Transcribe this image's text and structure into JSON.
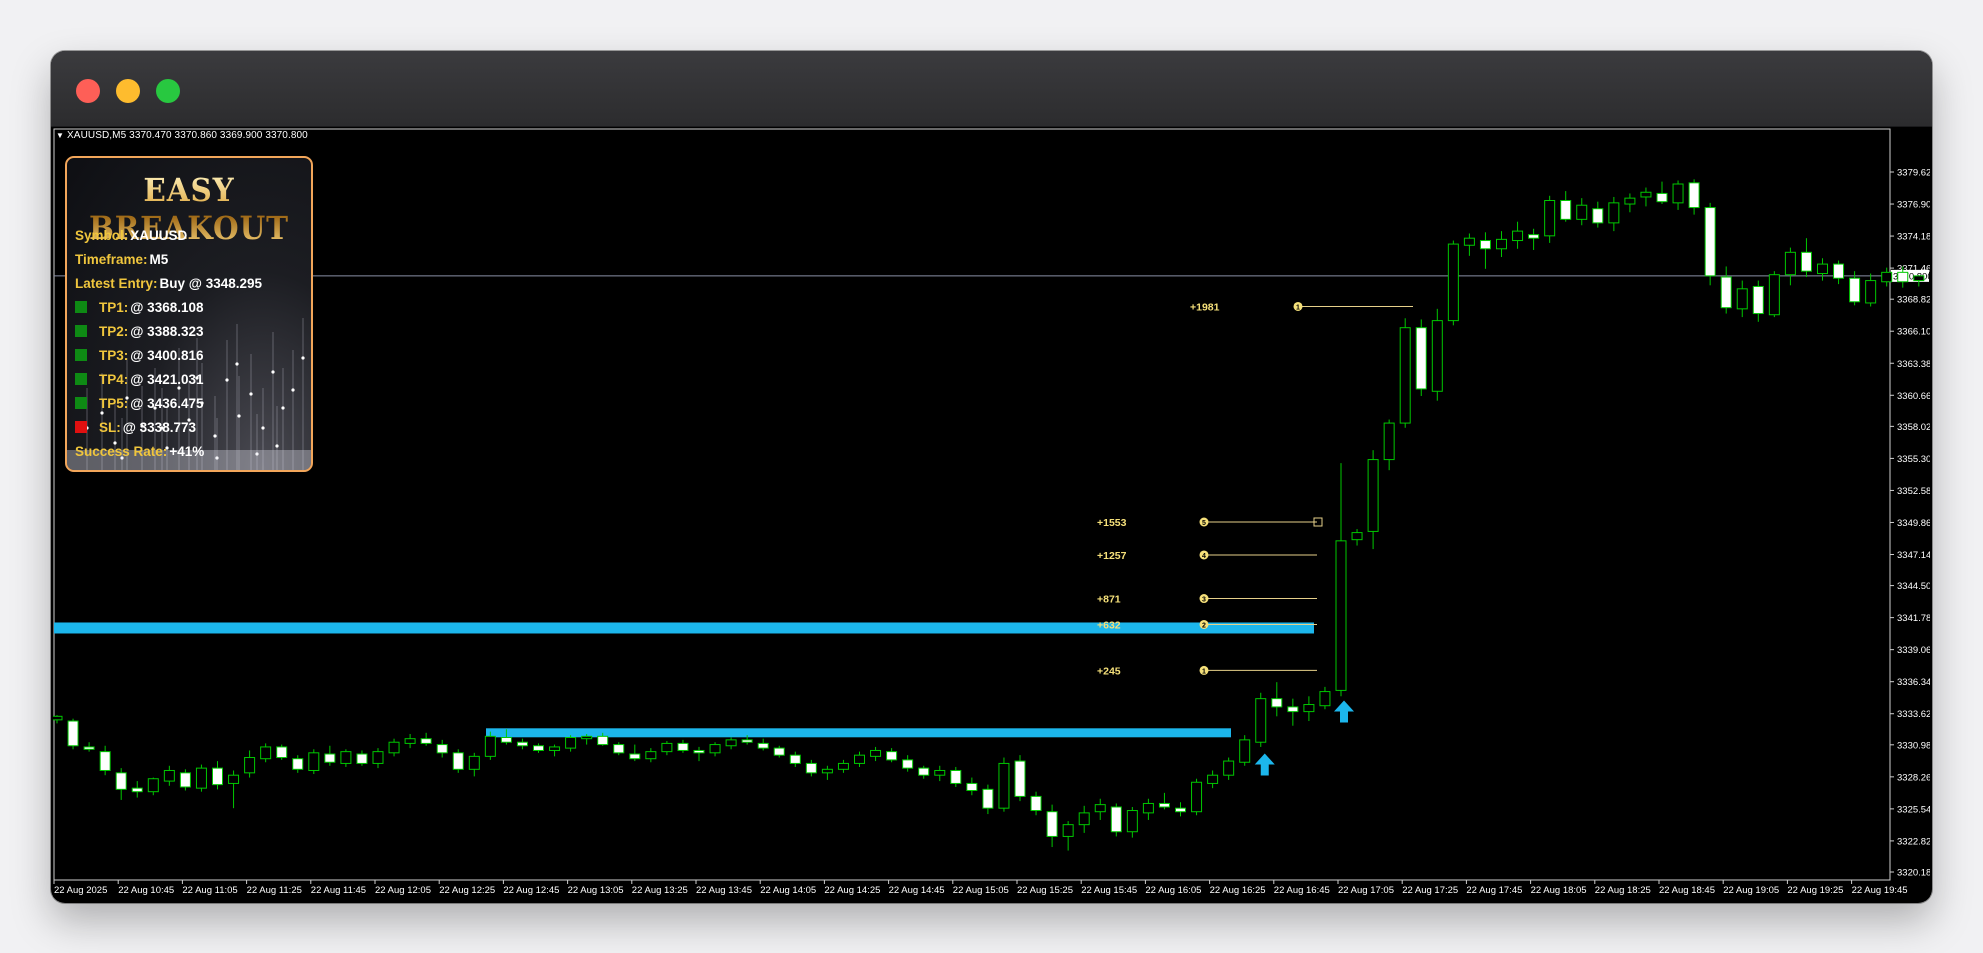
{
  "window": {
    "traffic_lights": {
      "close": "#fe5f57",
      "minimize": "#febc2e",
      "zoom": "#28c840"
    }
  },
  "chart": {
    "info_bar": "XAUUSD,M5  3370.470 3370.860 3369.900 3370.800",
    "current_price_label": "3370.800",
    "price_axis": [
      "3379.620",
      "3376.900",
      "3374.180",
      "3371.460",
      "3368.820",
      "3366.100",
      "3363.380",
      "3360.660",
      "3358.020",
      "3355.300",
      "3352.580",
      "3349.860",
      "3347.140",
      "3344.500",
      "3341.780",
      "3339.060",
      "3336.340",
      "3333.620",
      "3330.980",
      "3328.260",
      "3325.540",
      "3322.820",
      "3320.180"
    ],
    "time_axis": [
      "22 Aug 2025",
      "22 Aug 10:45",
      "22 Aug 11:05",
      "22 Aug 11:25",
      "22 Aug 11:45",
      "22 Aug 12:05",
      "22 Aug 12:25",
      "22 Aug 12:45",
      "22 Aug 13:05",
      "22 Aug 13:25",
      "22 Aug 13:45",
      "22 Aug 14:05",
      "22 Aug 14:25",
      "22 Aug 14:45",
      "22 Aug 15:05",
      "22 Aug 15:25",
      "22 Aug 15:45",
      "22 Aug 16:05",
      "22 Aug 16:25",
      "22 Aug 16:45",
      "22 Aug 17:05",
      "22 Aug 17:25",
      "22 Aug 17:45",
      "22 Aug 18:05",
      "22 Aug 18:25",
      "22 Aug 18:45",
      "22 Aug 19:05",
      "22 Aug 19:25",
      "22 Aug 19:45"
    ],
    "tp_labels": [
      {
        "label": "+1981",
        "marker": "1",
        "price": 3368.2
      },
      {
        "label": "+1553",
        "marker": "5",
        "price": 3349.9
      },
      {
        "label": "+1257",
        "marker": "4",
        "price": 3347.1
      },
      {
        "label": "+871",
        "marker": "3",
        "price": 3343.4
      },
      {
        "label": "+632",
        "marker": "2",
        "price": 3341.2
      },
      {
        "label": "+245",
        "marker": "1",
        "price": 3337.3
      }
    ],
    "colors": {
      "bull_candle": "#00c800",
      "bear_candle": "#ffffff",
      "breakout_zone": "#1cb6ec",
      "tp_line": "#e6d08a",
      "tp_text": "#f5e07a",
      "axis_text": "#ffffff"
    }
  },
  "panel": {
    "title": "EASY BREAKOUT",
    "symbol_label": "Symbol:",
    "symbol_value": "XAUUSD",
    "timeframe_label": "Timeframe:",
    "timeframe_value": "M5",
    "entry_label": "Latest Entry:",
    "entry_value": "Buy @ 3348.295",
    "targets": [
      {
        "label": "TP1:",
        "value": "@ 3368.108",
        "color": "#0e8a14"
      },
      {
        "label": "TP2:",
        "value": "@ 3388.323",
        "color": "#0e8a14"
      },
      {
        "label": "TP3:",
        "value": "@ 3400.816",
        "color": "#0e8a14"
      },
      {
        "label": "TP4:",
        "value": "@ 3421.031",
        "color": "#0e8a14"
      },
      {
        "label": "TP5:",
        "value": "@ 3436.475",
        "color": "#0e8a14"
      },
      {
        "label": "SL:",
        "value": "@ 3338.773",
        "color": "#e01010"
      }
    ],
    "success_label": "Success Rate:",
    "success_value": "+41%"
  }
}
